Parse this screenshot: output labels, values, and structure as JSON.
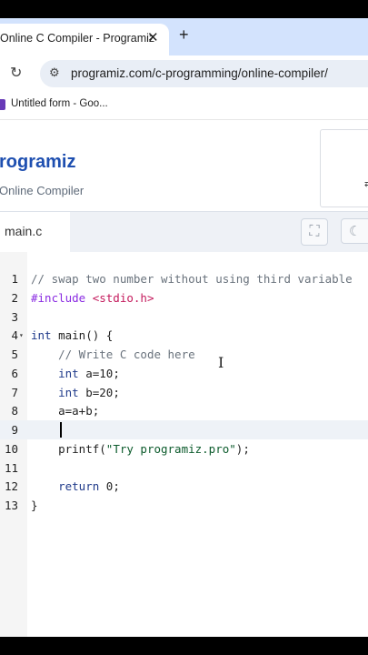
{
  "browser": {
    "tab_title": "Online C Compiler - Programiz",
    "tab_close": "✕",
    "new_tab": "+",
    "reload": "↻",
    "site_info": "⚙",
    "url": "programiz.com/c-programming/online-compiler/",
    "bookmark_label": "Untitled form - Goo..."
  },
  "header": {
    "logo": "rogramiz",
    "subtitle": "Online Compiler"
  },
  "editor": {
    "file_name": "main.c",
    "fullscreen_icon": "⛶",
    "theme_icon": "☾",
    "lines": [
      {
        "num": "1",
        "parts": [
          [
            "c-comment",
            "// swap two number without using third variable"
          ]
        ]
      },
      {
        "num": "2",
        "parts": [
          [
            "c-pre",
            "#include "
          ],
          [
            "c-inc",
            "<stdio.h>"
          ]
        ]
      },
      {
        "num": "3",
        "parts": []
      },
      {
        "num": "4",
        "fold": true,
        "parts": [
          [
            "c-kw",
            "int"
          ],
          [
            "",
            " main() {"
          ]
        ]
      },
      {
        "num": "5",
        "parts": [
          [
            "",
            "    "
          ],
          [
            "c-comment",
            "// Write C code here"
          ]
        ]
      },
      {
        "num": "6",
        "parts": [
          [
            "",
            "    "
          ],
          [
            "c-kw",
            "int"
          ],
          [
            "",
            " a=10;"
          ]
        ]
      },
      {
        "num": "7",
        "parts": [
          [
            "",
            "    "
          ],
          [
            "c-kw",
            "int"
          ],
          [
            "",
            " b=20;"
          ]
        ]
      },
      {
        "num": "8",
        "parts": [
          [
            "",
            "    a=a+b;"
          ]
        ]
      },
      {
        "num": "9",
        "active": true,
        "parts": []
      },
      {
        "num": "10",
        "parts": [
          [
            "",
            "    printf("
          ],
          [
            "c-str",
            "\"Try programiz.pro\""
          ],
          [
            "",
            ");"
          ]
        ]
      },
      {
        "num": "11",
        "parts": []
      },
      {
        "num": "12",
        "parts": [
          [
            "",
            "    "
          ],
          [
            "c-kw",
            "return"
          ],
          [
            "",
            " 0;"
          ]
        ]
      },
      {
        "num": "13",
        "parts": [
          [
            "",
            "}"
          ]
        ]
      }
    ]
  }
}
